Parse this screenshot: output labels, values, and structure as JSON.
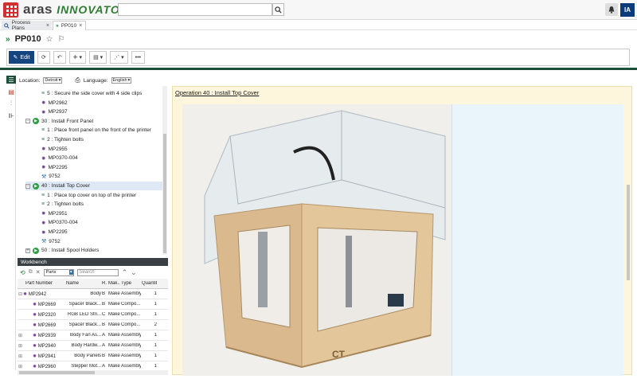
{
  "app": {
    "logo_main": "aras",
    "logo_sub": "INNOVATOR",
    "user_initials": "IA"
  },
  "tabs": [
    {
      "label": "Process Plans"
    },
    {
      "label": "PP010"
    }
  ],
  "page_title": "PP010",
  "toolbar": {
    "edit_label": "Edit"
  },
  "filters": {
    "location_label": "Location:",
    "location_value": "Detroit",
    "language_label": "Language:",
    "language_value": "English"
  },
  "tree": {
    "rows": [
      {
        "text": "5 : Secure the side cover with 4 side clips",
        "kind": "step"
      },
      {
        "text": "MP2962",
        "kind": "part"
      },
      {
        "text": "MP2937",
        "kind": "part"
      },
      {
        "text": "30 : Install Front Panel",
        "kind": "op"
      },
      {
        "text": "1 : Place front panel on the front of the printer",
        "kind": "step"
      },
      {
        "text": "2 : Tighten bolts",
        "kind": "step"
      },
      {
        "text": "MP2955",
        "kind": "part"
      },
      {
        "text": "MP0370-004",
        "kind": "part"
      },
      {
        "text": "MP2295",
        "kind": "part"
      },
      {
        "text": "9752",
        "kind": "tool"
      },
      {
        "text": "40 : Install Top Cover",
        "kind": "op"
      },
      {
        "text": "1 : Place top cover on top of the printer",
        "kind": "step"
      },
      {
        "text": "2 : Tighten bolts",
        "kind": "step"
      },
      {
        "text": "MP2951",
        "kind": "part"
      },
      {
        "text": "MP0370-004",
        "kind": "part"
      },
      {
        "text": "MP2295",
        "kind": "part"
      },
      {
        "text": "9752",
        "kind": "tool"
      },
      {
        "text": "50 : Install Spool Holders",
        "kind": "op"
      }
    ]
  },
  "workbench": {
    "title": "Workbench",
    "filter_value": "Parts",
    "search_placeholder": "Search",
    "columns": [
      "Part Number",
      "Name",
      "R.",
      "Mak...",
      "Type",
      "Quantity"
    ],
    "rows": [
      {
        "part": "MP2942",
        "name": "Body",
        "rev": "B",
        "make": "Make",
        "type": "Assembly",
        "qty": "1"
      },
      {
        "part": "MP2669",
        "name": "Spacer Black...",
        "rev": "B",
        "make": "Make",
        "type": "Compo...",
        "qty": "1"
      },
      {
        "part": "MP2320",
        "name": "RGB LED Stri...",
        "rev": "C",
        "make": "Make",
        "type": "Compo...",
        "qty": "1"
      },
      {
        "part": "MP2669",
        "name": "Spacer Black...",
        "rev": "B",
        "make": "Make",
        "type": "Compo...",
        "qty": "2"
      },
      {
        "part": "MP2939",
        "name": "Body Fan As...",
        "rev": "A",
        "make": "Make",
        "type": "Assembly",
        "qty": "1"
      },
      {
        "part": "MP2940",
        "name": "Body Hardw...",
        "rev": "A",
        "make": "Make",
        "type": "Assembly",
        "qty": "1"
      },
      {
        "part": "MP2941",
        "name": "Body Panels",
        "rev": "B",
        "make": "Make",
        "type": "Assembly",
        "qty": "1"
      },
      {
        "part": "MP2960",
        "name": "Stepper Mot...",
        "rev": "A",
        "make": "Make",
        "type": "Assembly",
        "qty": "1"
      }
    ]
  },
  "viewer": {
    "operation_link": "Operation 40 : Install Top Cover"
  }
}
